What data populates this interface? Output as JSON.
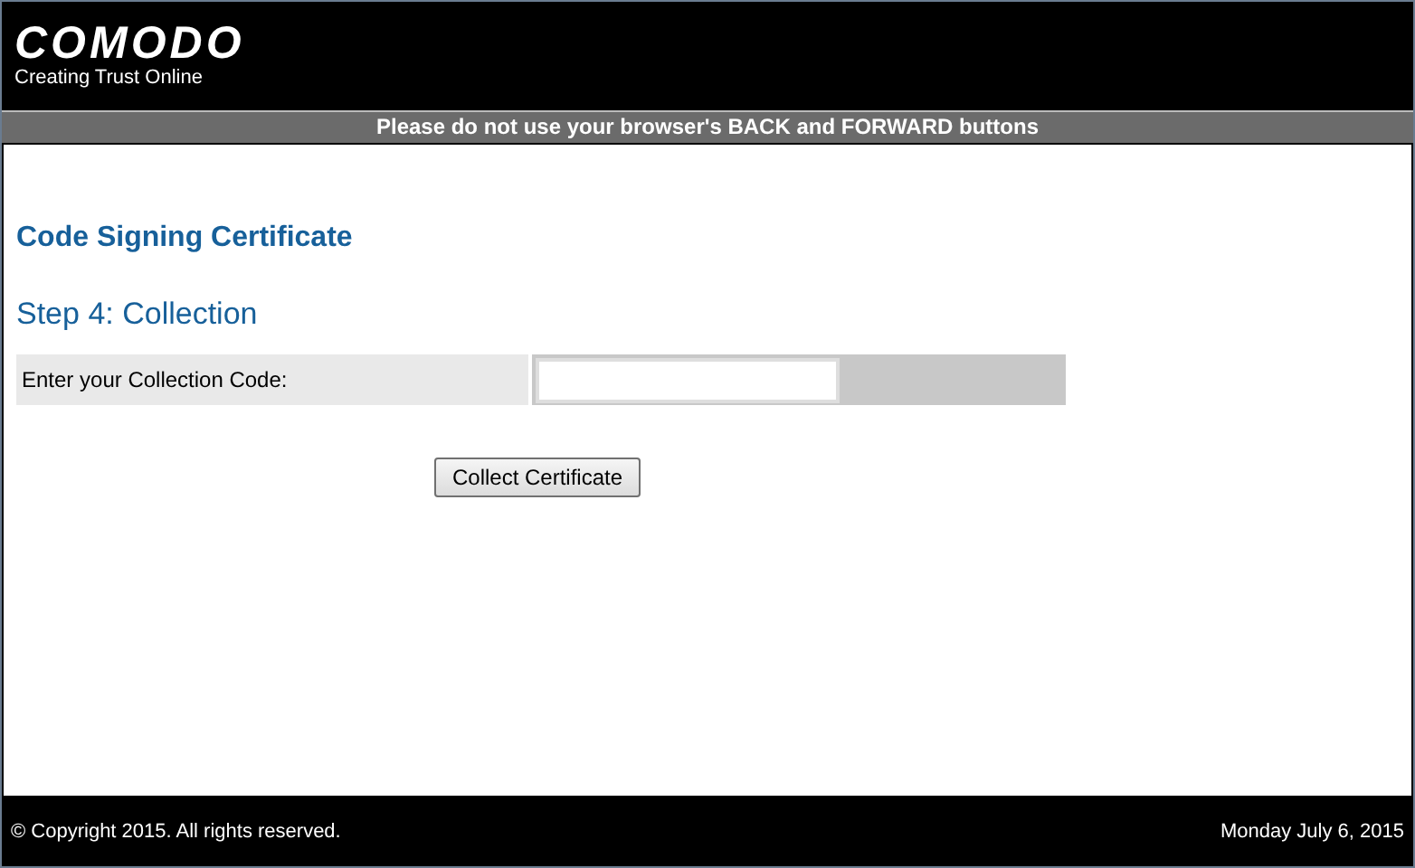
{
  "header": {
    "logo": "COMODO",
    "tagline": "Creating Trust Online"
  },
  "notice": "Please do not use your browser's BACK and FORWARD buttons",
  "title": "Code Signing Certificate",
  "step": "Step 4: Collection",
  "form": {
    "label": "Enter your Collection Code:"
  },
  "button": "Collect Certificate",
  "footer": {
    "copyright": "© Copyright 2015. All rights reserved.",
    "date": "Monday July 6, 2015"
  }
}
